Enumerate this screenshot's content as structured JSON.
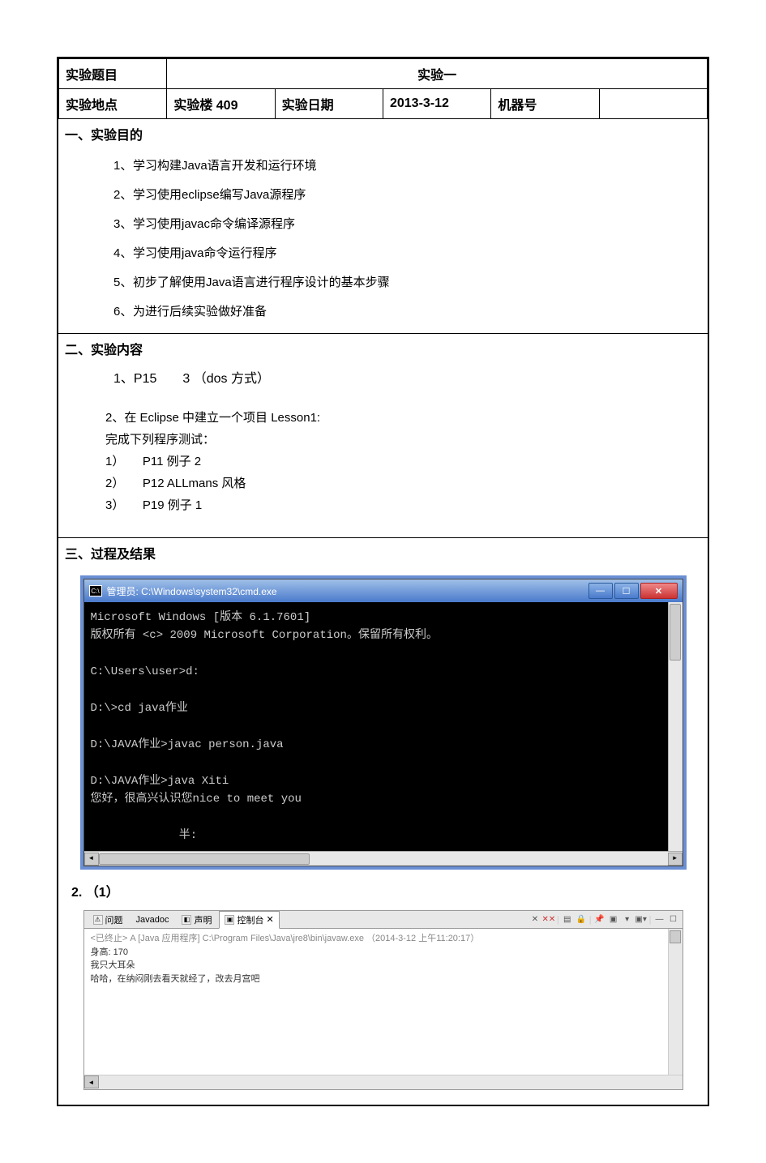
{
  "header": {
    "title_label": "实验题目",
    "title_value": "实验一",
    "location_label": "实验地点",
    "location_value": "实验楼 409",
    "date_label": "实验日期",
    "date_value": "2013-3-12",
    "machine_label": "机器号",
    "machine_value": ""
  },
  "section1": {
    "heading": "一、实验目的",
    "items": [
      {
        "num": "1、",
        "text": "学习构建Java语言开发和运行环境"
      },
      {
        "num": "2、",
        "text": "学习使用eclipse编写Java源程序"
      },
      {
        "num": "3、",
        "text": "学习使用javac命令编译源程序"
      },
      {
        "num": "4、",
        "text": "学习使用java命令运行程序"
      },
      {
        "num": "5、",
        "text": "初步了解使用Java语言进行程序设计的基本步骤"
      },
      {
        "num": "6、",
        "text": "为进行后续实验做好准备"
      }
    ]
  },
  "section2": {
    "heading": "二、实验内容",
    "item1": "1、P15　　3 （dos 方式）",
    "item2a": "2、在 Eclipse 中建立一个项目 Lesson1:",
    "item2b": "完成下列程序测试：",
    "sub": [
      "1）　　P11 例子 2",
      "2）　　P12 ALLmans 风格",
      "3）　　P19 例子 1"
    ]
  },
  "section3": {
    "heading": "三、过程及结果",
    "cmd": {
      "title_prefix": "管理员: ",
      "title_path": "C:\\Windows\\system32\\cmd.exe",
      "lines": "Microsoft Windows [版本 6.1.7601]\n版权所有 <c> 2009 Microsoft Corporation。保留所有权利。\n\nC:\\Users\\user>d:\n\nD:\\>cd java作业\n\nD:\\JAVA作业>javac person.java\n\nD:\\JAVA作业>java Xiti\n您好，很高兴认识您nice to meet you\n\n             半:"
    },
    "item2_label": "2.   （1）",
    "eclipse": {
      "tabs": {
        "problems": "问题",
        "javadoc": "Javadoc",
        "declaration": "声明",
        "console": "控制台"
      },
      "console_close": "✕",
      "status": "<已终止> A [Java 应用程序] C:\\Program Files\\Java\\jre8\\bin\\javaw.exe （2014-3-12 上午11:20:17）",
      "out1": "身高: 170",
      "out2": "我只大耳朵",
      "out3": "哈哈，在纳闷刚去看天就经了，改去月宫吧"
    }
  },
  "icons": {
    "min": "—",
    "max": "☐",
    "close": "✕",
    "cmd_icon": "C:\\",
    "left_arrow": "◄",
    "right_arrow": "►",
    "up_arrow": "▲",
    "down_arrow": "▼"
  }
}
